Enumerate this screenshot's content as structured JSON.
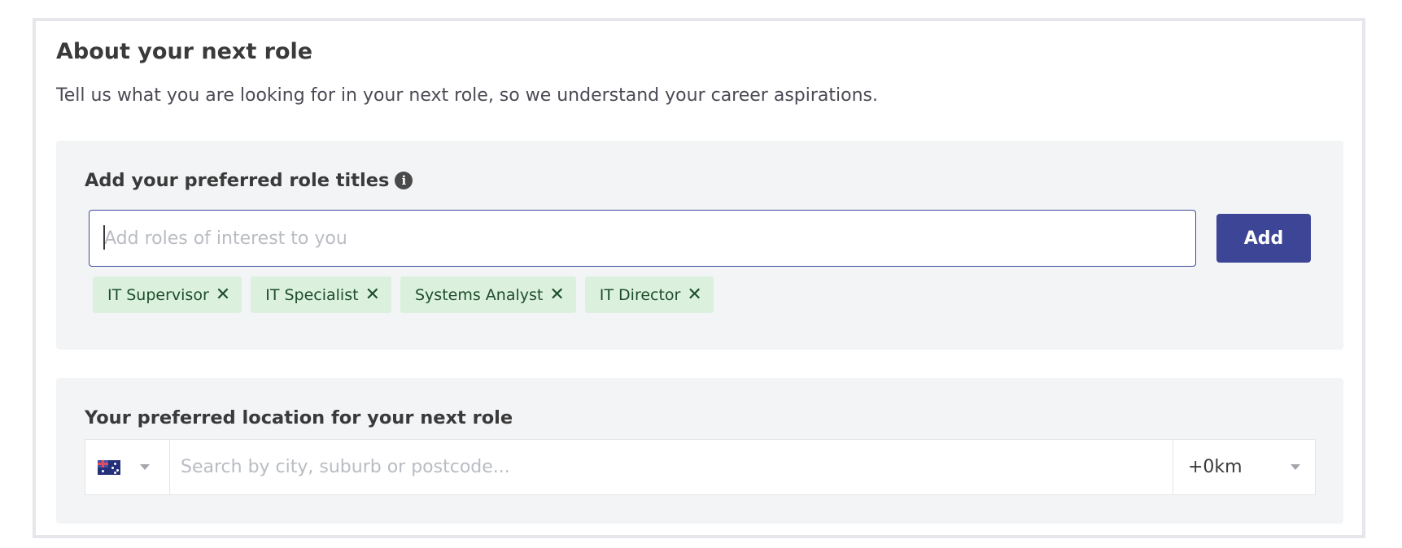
{
  "section": {
    "title": "About your next role",
    "subtitle": "Tell us what you are looking for in your next role, so we understand your career aspirations."
  },
  "roles": {
    "label": "Add your preferred role titles",
    "info_icon": "info-circle-icon",
    "input_placeholder": "Add roles of interest to you",
    "input_value": "",
    "add_label": "Add",
    "chips": [
      {
        "label": "IT Supervisor",
        "close_glyph": "✕"
      },
      {
        "label": "IT Specialist",
        "close_glyph": "✕"
      },
      {
        "label": "Systems Analyst",
        "close_glyph": "✕"
      },
      {
        "label": "IT Director",
        "close_glyph": "✕"
      }
    ]
  },
  "location": {
    "label": "Your preferred location for your next role",
    "country_flag": "australia-flag-icon",
    "input_placeholder": "Search by city, suburb or postcode...",
    "input_value": "",
    "radius_value": "+0km"
  },
  "colors": {
    "accent": "#3d4596",
    "chip_bg": "#dbf1de",
    "chip_text": "#1e4d2b",
    "panel_bg": "#f3f4f6"
  }
}
